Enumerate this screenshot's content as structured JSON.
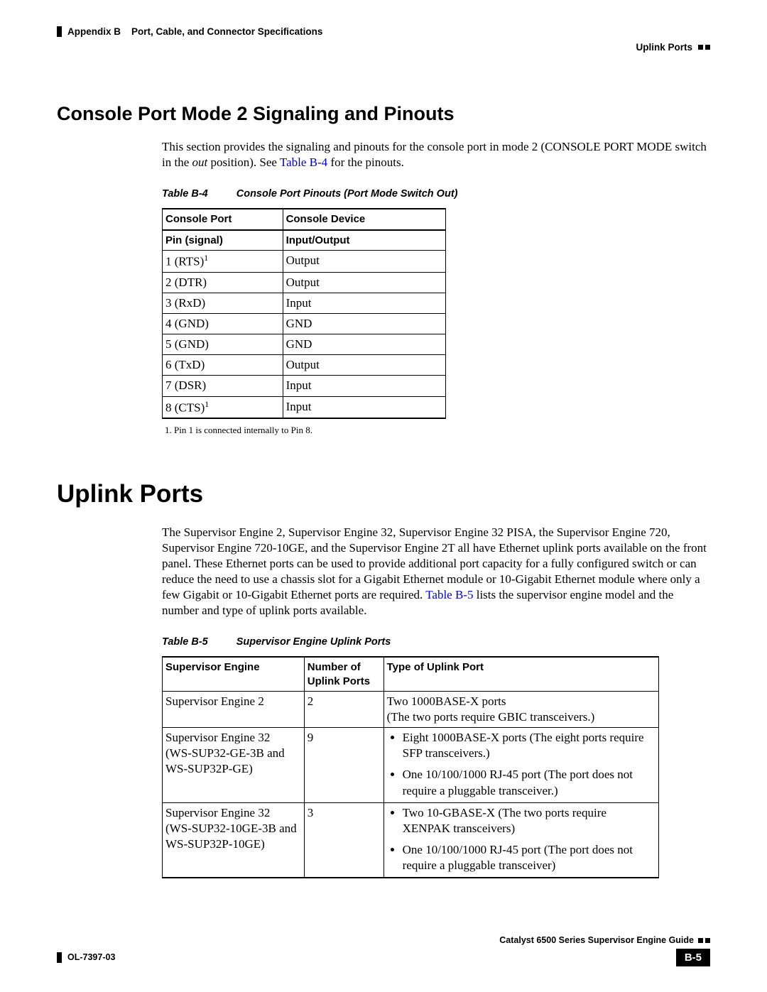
{
  "header": {
    "appendix": "Appendix B",
    "chapter": "Port, Cable, and Connector Specifications",
    "section": "Uplink Ports"
  },
  "section1": {
    "title": "Console Port Mode 2 Signaling and Pinouts",
    "para_pre": "This section provides the signaling and pinouts for the console port in mode 2 (CONSOLE PORT MODE switch in the ",
    "para_italic": "out",
    "para_mid": " position). See ",
    "para_link": "Table B-4",
    "para_post": " for the pinouts."
  },
  "table1": {
    "label": "Table B-4",
    "title": "Console Port Pinouts (Port Mode Switch Out)",
    "h1a": "Console Port",
    "h1b": "Console Device",
    "h2a": "Pin (signal)",
    "h2b": "Input/Output",
    "rows": [
      {
        "pin": "1 (RTS)",
        "sup": "1",
        "io": "Output"
      },
      {
        "pin": "2 (DTR)",
        "sup": "",
        "io": "Output"
      },
      {
        "pin": "3 (RxD)",
        "sup": "",
        "io": "Input"
      },
      {
        "pin": "4 (GND)",
        "sup": "",
        "io": "GND"
      },
      {
        "pin": "5 (GND)",
        "sup": "",
        "io": "GND"
      },
      {
        "pin": "6 (TxD)",
        "sup": "",
        "io": "Output"
      },
      {
        "pin": "7 (DSR)",
        "sup": "",
        "io": "Input"
      },
      {
        "pin": "8 (CTS)",
        "sup": "1",
        "io": "Input"
      }
    ],
    "footnote": "1.  Pin 1 is connected internally to Pin 8."
  },
  "section2": {
    "title": "Uplink Ports",
    "para_pre": "The Supervisor Engine 2, Supervisor Engine 32, Supervisor Engine 32 PISA, the Supervisor Engine 720, Supervisor Engine 720-10GE, and the Supervisor Engine 2T all have Ethernet uplink ports available on the front panel. These Ethernet ports can be used to provide additional port capacity for a fully configured switch or can reduce the need to use a chassis slot for a Gigabit Ethernet module or 10-Gigabit Ethernet module where only a few Gigabit or 10-Gigabit Ethernet ports are required. ",
    "para_link": "Table B-5",
    "para_post": " lists the supervisor engine model and the number and type of uplink ports available."
  },
  "table2": {
    "label": "Table B-5",
    "title": "Supervisor Engine Uplink Ports",
    "h1": "Supervisor Engine",
    "h2a": "Number of",
    "h2b": "Uplink Ports",
    "h3": "Type of Uplink Port",
    "rows": [
      {
        "engine": "Supervisor Engine 2",
        "sub": "",
        "num": "2",
        "type_plain_a": "Two 1000BASE-X ports",
        "type_plain_b": "(The two ports require GBIC transceivers.)",
        "list": []
      },
      {
        "engine": "Supervisor Engine 32",
        "sub": "(WS-SUP32-GE-3B and WS-SUP32P-GE)",
        "num": "9",
        "type_plain_a": "",
        "type_plain_b": "",
        "list": [
          "Eight 1000BASE-X ports (The eight ports require SFP transceivers.)",
          "One 10/100/1000 RJ-45 port (The port does not require a pluggable transceiver.)"
        ]
      },
      {
        "engine": "Supervisor Engine 32",
        "sub": "(WS-SUP32-10GE-3B and WS-SUP32P-10GE)",
        "num": "3",
        "type_plain_a": "",
        "type_plain_b": "",
        "list": [
          "Two 10-GBASE-X (The two ports require XENPAK transceivers)",
          "One 10/100/1000 RJ-45 port (The port does not require a pluggable transceiver)"
        ]
      }
    ]
  },
  "footer": {
    "guide": "Catalyst 6500 Series Supervisor Engine Guide",
    "doc": "OL-7397-03",
    "page": "B-5"
  }
}
